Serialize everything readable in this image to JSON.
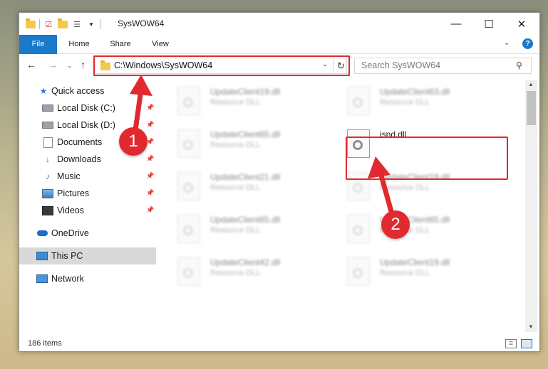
{
  "window": {
    "title": "SysWOW64",
    "minimize_glyph": "—",
    "maximize_glyph": "☐",
    "close_glyph": "✕"
  },
  "ribbon": {
    "tabs": [
      {
        "label": "File",
        "active": true
      },
      {
        "label": "Home",
        "active": false
      },
      {
        "label": "Share",
        "active": false
      },
      {
        "label": "View",
        "active": false
      }
    ],
    "help_glyph": "?"
  },
  "navigation": {
    "address": "C:\\Windows\\SysWOW64",
    "search_placeholder": "Search SysWOW64"
  },
  "sidebar": {
    "items": [
      {
        "label": "Quick access",
        "icon": "star-icon",
        "pinned": false
      },
      {
        "label": "Local Disk (C:)",
        "icon": "drive-icon",
        "pinned": true
      },
      {
        "label": "Local Disk (D:)",
        "icon": "drive-icon",
        "pinned": true
      },
      {
        "label": "Documents",
        "icon": "documents-icon",
        "pinned": true
      },
      {
        "label": "Downloads",
        "icon": "downloads-icon",
        "pinned": true
      },
      {
        "label": "Music",
        "icon": "music-icon",
        "pinned": true
      },
      {
        "label": "Pictures",
        "icon": "pictures-icon",
        "pinned": true
      },
      {
        "label": "Videos",
        "icon": "videos-icon",
        "pinned": true
      },
      {
        "label": "OneDrive",
        "icon": "onedrive-icon",
        "pinned": false
      },
      {
        "label": "This PC",
        "icon": "this-pc-icon",
        "pinned": false,
        "selected": true
      },
      {
        "label": "Network",
        "icon": "network-icon",
        "pinned": false
      }
    ]
  },
  "files": {
    "left_column": [
      {
        "name": "UpdateClient19.dll",
        "type": "Resource DLL"
      },
      {
        "name": "UpdateClient65.dll",
        "type": "Resource DLL"
      },
      {
        "name": "UpdateClient21.dll",
        "type": "Resource DLL"
      },
      {
        "name": "UpdateClient65.dll",
        "type": "Resource DLL"
      },
      {
        "name": "UpdateClient42.dll",
        "type": "Resource DLL"
      }
    ],
    "right_column": [
      {
        "name": "UpdateClient63.dll",
        "type": "Resource DLL"
      },
      {
        "name": "isnd.dll",
        "type": ""
      },
      {
        "name": "UpdateClient19.dll",
        "type": "Resource DLL"
      },
      {
        "name": "UpdateClient65.dll",
        "type": "Resource DLL"
      },
      {
        "name": "UpdateClient19.dll",
        "type": "Resource DLL"
      }
    ]
  },
  "status": {
    "item_count": "186 items"
  },
  "annotations": {
    "step1": "1",
    "step2": "2",
    "highlight_color": "#e02a2f"
  },
  "colors": {
    "accent": "#1979ca",
    "selection": "#d9d9d9"
  }
}
